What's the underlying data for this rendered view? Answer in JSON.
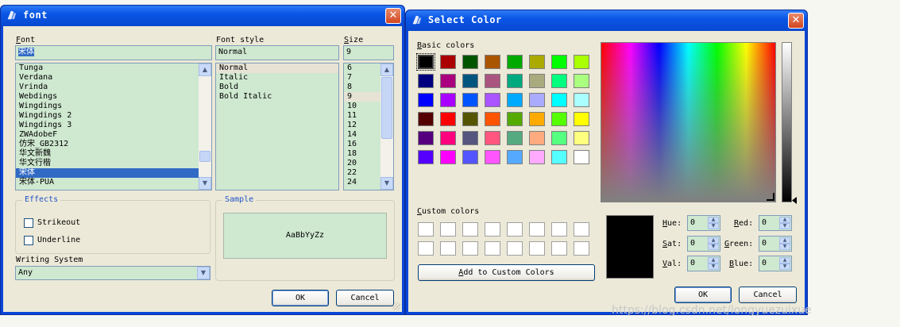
{
  "font_dialog": {
    "title": "font",
    "close_glyph": "✕",
    "font_label": "Font",
    "font_value": "宋体",
    "font_list": [
      "Tunga",
      "Verdana",
      "Vrinda",
      "Webdings",
      "Wingdings",
      "Wingdings 2",
      "Wingdings 3",
      "ZWAdobeF",
      "仿宋_GB2312",
      "华文新魏",
      "华文行楷",
      "宋体",
      "宋体-PUA"
    ],
    "font_selected": "宋体",
    "style_label": "Font style",
    "style_value": "Normal",
    "style_list": [
      "Normal",
      "Italic",
      "Bold",
      "Bold Italic"
    ],
    "size_label": "Size",
    "size_value": "9",
    "size_list": [
      "6",
      "7",
      "8",
      "9",
      "10",
      "11",
      "12",
      "14",
      "16",
      "18",
      "20",
      "22",
      "24"
    ],
    "effects_label": "Effects",
    "strikeout_label": "Strikeout",
    "underline_label": "Underline",
    "sample_label": "Sample",
    "sample_text": "AaBbYyZz",
    "writing_label": "Writing System",
    "writing_value": "Any",
    "ok_label": "OK",
    "cancel_label": "Cancel"
  },
  "color_dialog": {
    "title": "Select Color",
    "close_glyph": "✕",
    "basic_label": "Basic colors",
    "basic_colors": [
      [
        "#000000",
        "#aa0000",
        "#005500",
        "#aa5500",
        "#00aa00",
        "#aaaa00",
        "#00ff00",
        "#aaff00"
      ],
      [
        "#00007f",
        "#aa007f",
        "#00557f",
        "#aa557f",
        "#00aa7f",
        "#aaaa7f",
        "#00ff7f",
        "#aaff7f"
      ],
      [
        "#0000ff",
        "#aa00ff",
        "#0055ff",
        "#aa55ff",
        "#00aaff",
        "#aaaaff",
        "#00ffff",
        "#aaffff"
      ],
      [
        "#550000",
        "#ff0000",
        "#555500",
        "#ff5500",
        "#55aa00",
        "#ffaa00",
        "#55ff00",
        "#ffff00"
      ],
      [
        "#55007f",
        "#ff007f",
        "#55557f",
        "#ff557f",
        "#55aa7f",
        "#ffaa7f",
        "#55ff7f",
        "#ffff7f"
      ],
      [
        "#5500ff",
        "#ff00ff",
        "#5555ff",
        "#ff55ff",
        "#55aaff",
        "#ffaaff",
        "#55ffff",
        "#ffffff"
      ]
    ],
    "custom_label": "Custom colors",
    "add_custom_label": "Add to Custom Colors",
    "current_color": "#000000",
    "hue_label": "Hue:",
    "hue_value": "0",
    "sat_label": "Sat:",
    "sat_value": "0",
    "val_label": "Val:",
    "val_value": "0",
    "red_label": "Red:",
    "red_value": "0",
    "green_label": "Green:",
    "green_value": "0",
    "blue_label": "Blue:",
    "blue_value": "0",
    "ok_label": "OK",
    "cancel_label": "Cancel"
  },
  "watermark": "https://blog.csdn.net/longyuezuixue"
}
